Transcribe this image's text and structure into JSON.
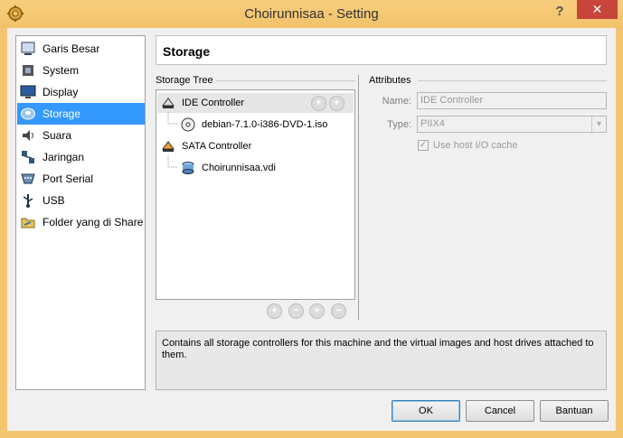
{
  "window": {
    "title": "Choirunnisaa - Setting",
    "help_label": "?",
    "close_label": "✕"
  },
  "nav": {
    "items": [
      {
        "label": "Garis Besar",
        "icon": "general-icon"
      },
      {
        "label": "System",
        "icon": "system-chip-icon"
      },
      {
        "label": "Display",
        "icon": "monitor-icon"
      },
      {
        "label": "Storage",
        "icon": "disk-icon",
        "active": true
      },
      {
        "label": "Suara",
        "icon": "speaker-icon"
      },
      {
        "label": "Jaringan",
        "icon": "network-icon"
      },
      {
        "label": "Port Serial",
        "icon": "serial-port-icon"
      },
      {
        "label": "USB",
        "icon": "usb-icon"
      },
      {
        "label": "Folder yang di Share",
        "icon": "shared-folder-icon"
      }
    ]
  },
  "header": {
    "title": "Storage"
  },
  "storage_tree": {
    "label": "Storage Tree",
    "controllers": [
      {
        "name": "IDE Controller",
        "icon": "ide-controller-icon",
        "attachments": [
          {
            "name": "debian-7.1.0-i386-DVD-1.iso",
            "icon": "optical-disc-icon"
          }
        ]
      },
      {
        "name": "SATA Controller",
        "icon": "sata-controller-icon",
        "attachments": [
          {
            "name": "Choirunnisaa.vdi",
            "icon": "hard-disk-icon"
          }
        ]
      }
    ]
  },
  "attributes": {
    "label": "Attributes",
    "name_label": "Name:",
    "name_value": "IDE Controller",
    "type_label": "Type:",
    "type_value": "PIIX4",
    "use_host_cache_label": "Use host I/O cache",
    "use_host_cache_checked": true
  },
  "description": "Contains all storage controllers for this machine and the virtual images and host drives attached to them.",
  "buttons": {
    "ok": "OK",
    "cancel": "Cancel",
    "help": "Bantuan"
  },
  "colors": {
    "accent": "#3399ff",
    "titlebar": "#f4c570",
    "close": "#c7453b"
  }
}
